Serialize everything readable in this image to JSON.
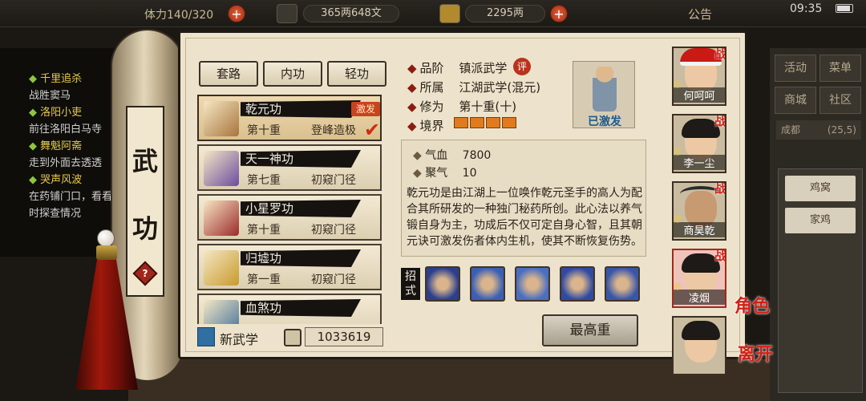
{
  "topbar": {
    "stamina_label": "体力",
    "stamina": "140/320",
    "money": "365两648文",
    "gold": "2295两",
    "notice": "公告",
    "time": "09:35"
  },
  "quest_log": [
    {
      "title": "千里追杀",
      "desc": "战胜窦马"
    },
    {
      "title": "洛阳小吏",
      "desc": "前往洛阳白马寺"
    },
    {
      "title": "舞魁阿斋",
      "desc": "走到外面去透透"
    },
    {
      "title": "哭声风波",
      "desc": "在药铺门口，看看"
    },
    {
      "title": "",
      "desc": "时探查情况"
    }
  ],
  "side_menu": {
    "buttons": [
      "活动",
      "菜单",
      "商城",
      "社区"
    ],
    "location": "成都",
    "coords": "(25,5)",
    "list": [
      "鸡窝",
      "家鸡"
    ]
  },
  "scroll": {
    "title_chars": [
      "武",
      "功"
    ],
    "help": "?"
  },
  "tabs": [
    "套路",
    "内功",
    "轻功"
  ],
  "skills": [
    {
      "name": "乾元功",
      "level": "第十重",
      "rank": "登峰造极",
      "badge": "激发",
      "selected": true,
      "icon_color": "#a8743c"
    },
    {
      "name": "天一神功",
      "level": "第七重",
      "rank": "初窥门径",
      "badge": "",
      "selected": false,
      "icon_color": "#6b4ca0"
    },
    {
      "name": "小星罗功",
      "level": "第十重",
      "rank": "初窥门径",
      "badge": "",
      "selected": false,
      "icon_color": "#9c2a2a"
    },
    {
      "name": "归墟功",
      "level": "第一重",
      "rank": "初窥门径",
      "badge": "",
      "selected": false,
      "icon_color": "#c79a2c"
    },
    {
      "name": "血煞功",
      "level": "",
      "rank": "",
      "badge": "",
      "selected": false,
      "icon_color": "#3f6f9c"
    }
  ],
  "footer": {
    "new_skill": "新武学",
    "count": "1033619"
  },
  "detail": {
    "grade_label": "品阶",
    "grade": "镇派武学",
    "ping": "评",
    "belong_label": "所属",
    "belong": "江湖武学(混元)",
    "cultivation_label": "修为",
    "cultivation": "第十重(十)",
    "realm_label": "境界",
    "realm_segments": 4,
    "activated": "已激发",
    "stats": [
      {
        "label": "气血",
        "value": "7800"
      },
      {
        "label": "聚气",
        "value": "10"
      }
    ],
    "description": "乾元功是由江湖上一位唤作乾元圣手的高人为配合其所研发的一种独门秘药所创。此心法以养气锻自身为主，功成后不仅可定自身心智，且其朝元诀可激发伤者体内生机，使其不断恢复伤势。",
    "moves_label": "招式",
    "move_colors": [
      "#2b3f8c",
      "#3a5fb3",
      "#4a6fc0",
      "#2f4aa0",
      "#3856a8"
    ],
    "max_button": "最高重"
  },
  "characters": [
    {
      "name": "何呵呵",
      "hat": "santa",
      "selected": false
    },
    {
      "name": "李一尘",
      "hat": "hair",
      "selected": false
    },
    {
      "name": "商昊乾",
      "hat": "horns",
      "selected": false
    },
    {
      "name": "凌烟",
      "hat": "hair",
      "selected": true
    },
    {
      "name": "",
      "hat": "hair",
      "selected": false
    }
  ],
  "side_tags": {
    "battle": "战",
    "role": "角色",
    "leave": "离开",
    "cultivate": "修"
  }
}
